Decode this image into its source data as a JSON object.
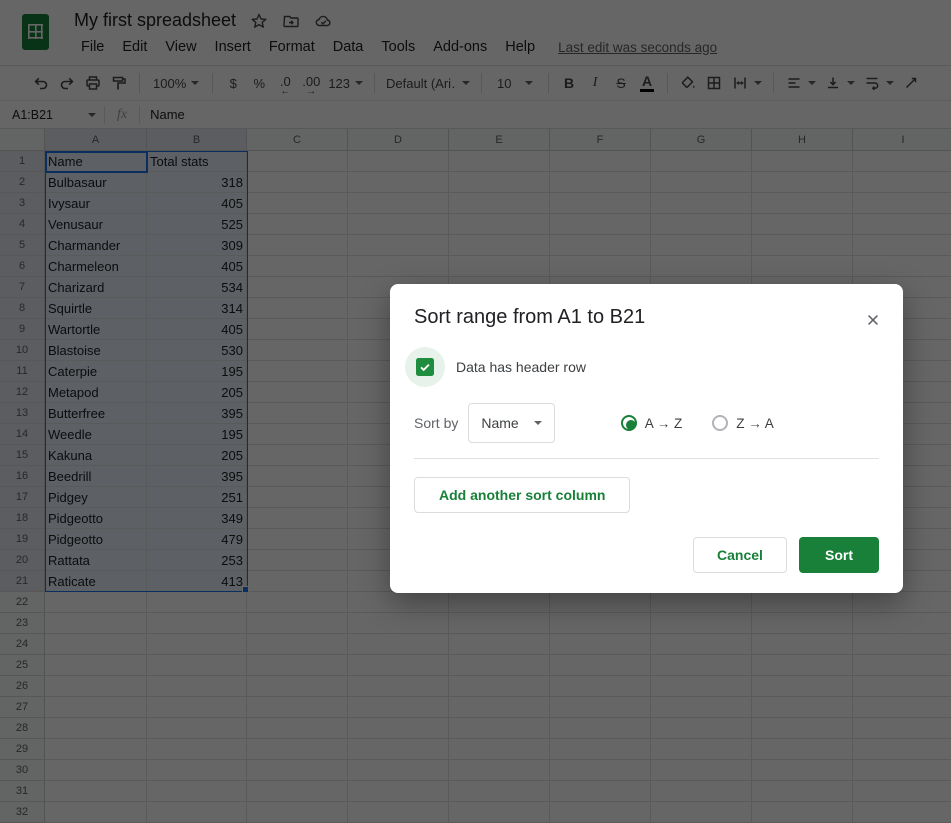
{
  "header": {
    "title": "My first spreadsheet",
    "menus": [
      "File",
      "Edit",
      "View",
      "Insert",
      "Format",
      "Data",
      "Tools",
      "Add-ons",
      "Help"
    ],
    "last_edit": "Last edit was seconds ago"
  },
  "toolbar": {
    "zoom": "100%",
    "currency": "$",
    "percent": "%",
    "decrease_decimal": ".0",
    "increase_decimal": ".00",
    "more_formats": "123",
    "font": "Default (Ari…",
    "font_size": "10",
    "bold": "B",
    "italic": "I",
    "strikethrough": "S",
    "text_color": "A"
  },
  "formula_bar": {
    "name_box": "A1:B21",
    "fx_label": "fx",
    "content": "Name"
  },
  "grid": {
    "columns": [
      "A",
      "B",
      "C",
      "D",
      "E",
      "F",
      "G",
      "H",
      "I"
    ],
    "row_count": 32,
    "selected_columns": [
      "A",
      "B"
    ],
    "selected_row_end": 21,
    "selection_range": "A1:B21",
    "cells": [
      [
        "Name",
        "Total stats"
      ],
      [
        "Bulbasaur",
        "318"
      ],
      [
        "Ivysaur",
        "405"
      ],
      [
        "Venusaur",
        "525"
      ],
      [
        "Charmander",
        "309"
      ],
      [
        "Charmeleon",
        "405"
      ],
      [
        "Charizard",
        "534"
      ],
      [
        "Squirtle",
        "314"
      ],
      [
        "Wartortle",
        "405"
      ],
      [
        "Blastoise",
        "530"
      ],
      [
        "Caterpie",
        "195"
      ],
      [
        "Metapod",
        "205"
      ],
      [
        "Butterfree",
        "395"
      ],
      [
        "Weedle",
        "195"
      ],
      [
        "Kakuna",
        "205"
      ],
      [
        "Beedrill",
        "395"
      ],
      [
        "Pidgey",
        "251"
      ],
      [
        "Pidgeotto",
        "349"
      ],
      [
        "Pidgeotto",
        "479"
      ],
      [
        "Rattata",
        "253"
      ],
      [
        "Raticate",
        "413"
      ]
    ]
  },
  "dialog": {
    "title": "Sort range from A1 to B21",
    "header_checkbox_label": "Data has header row",
    "checkbox_checked": true,
    "sort_by_label": "Sort by",
    "sort_by_value": "Name",
    "asc_label": "A → Z",
    "desc_label": "Z → A",
    "asc_selected": true,
    "add_column_label": "Add another sort column",
    "cancel_label": "Cancel",
    "sort_label": "Sort",
    "colors": {
      "green": "#188038",
      "checkbox_green": "#1e8e3e",
      "selection_blue": "#1a73e8"
    }
  }
}
